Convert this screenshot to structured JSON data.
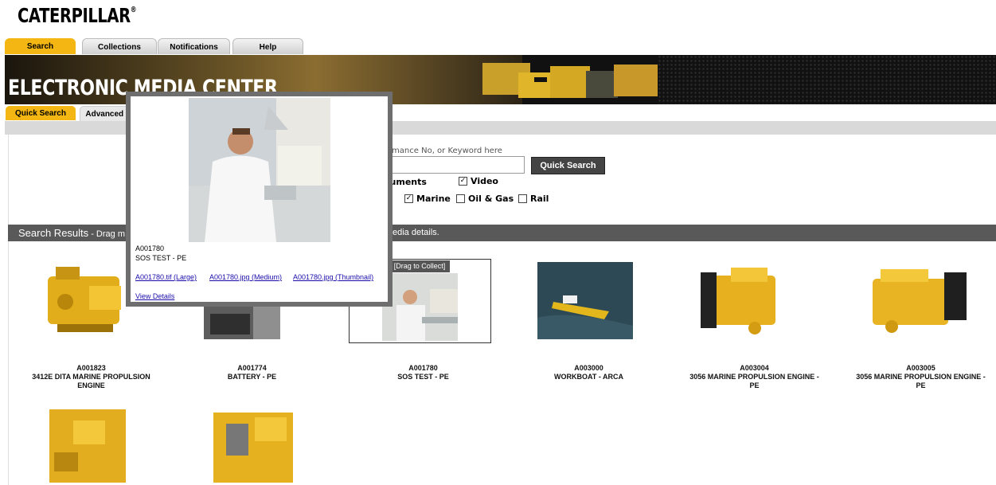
{
  "brand": {
    "name": "CATERPILLAR",
    "mark": "®"
  },
  "main_tabs": [
    {
      "label": "Search"
    },
    {
      "label": "Collections"
    },
    {
      "label": "Notifications"
    },
    {
      "label": "Help"
    }
  ],
  "banner": {
    "title": "ELECTRONIC MEDIA CENTER"
  },
  "sub_tabs": [
    {
      "label": "Quick Search"
    },
    {
      "label": "Advanced S"
    }
  ],
  "search": {
    "hint": "ormance No, or Keyword here",
    "button": "Quick Search",
    "filters_row1": [
      {
        "label": "cuments",
        "checked": null
      },
      {
        "label": "Video",
        "checked": true
      }
    ],
    "filters_row2": [
      {
        "label": "Marine",
        "checked": true
      },
      {
        "label": "Oil & Gas",
        "checked": false
      },
      {
        "label": "Rail",
        "checked": false
      }
    ]
  },
  "results_bar": {
    "title": "Search Results",
    "sub": " - Drag m",
    "tail": "edia details."
  },
  "drag_label": "[Drag to Collect]",
  "results": [
    {
      "id": "A001823",
      "name": "3412E DITA MARINE PROPULSION ENGINE"
    },
    {
      "id": "A001774",
      "name": "BATTERY - PE"
    },
    {
      "id": "A001780",
      "name": "SOS TEST - PE"
    },
    {
      "id": "A003000",
      "name": "WORKBOAT - ARCA"
    },
    {
      "id": "A003004",
      "name": "3056 MARINE PROPULSION ENGINE - PE"
    },
    {
      "id": "A003005",
      "name": "3056 MARINE PROPULSION ENGINE - PE"
    }
  ],
  "popup": {
    "id": "A001780",
    "name": "SOS TEST - PE",
    "links": [
      "A001780.tif (Large)",
      "A001780.jpg (Medium)",
      "A001780.jpg (Thumbnail)"
    ],
    "view_details": "View Details"
  },
  "colors": {
    "accent": "#f3b612",
    "bar": "#595959",
    "link": "#1a0dab"
  }
}
